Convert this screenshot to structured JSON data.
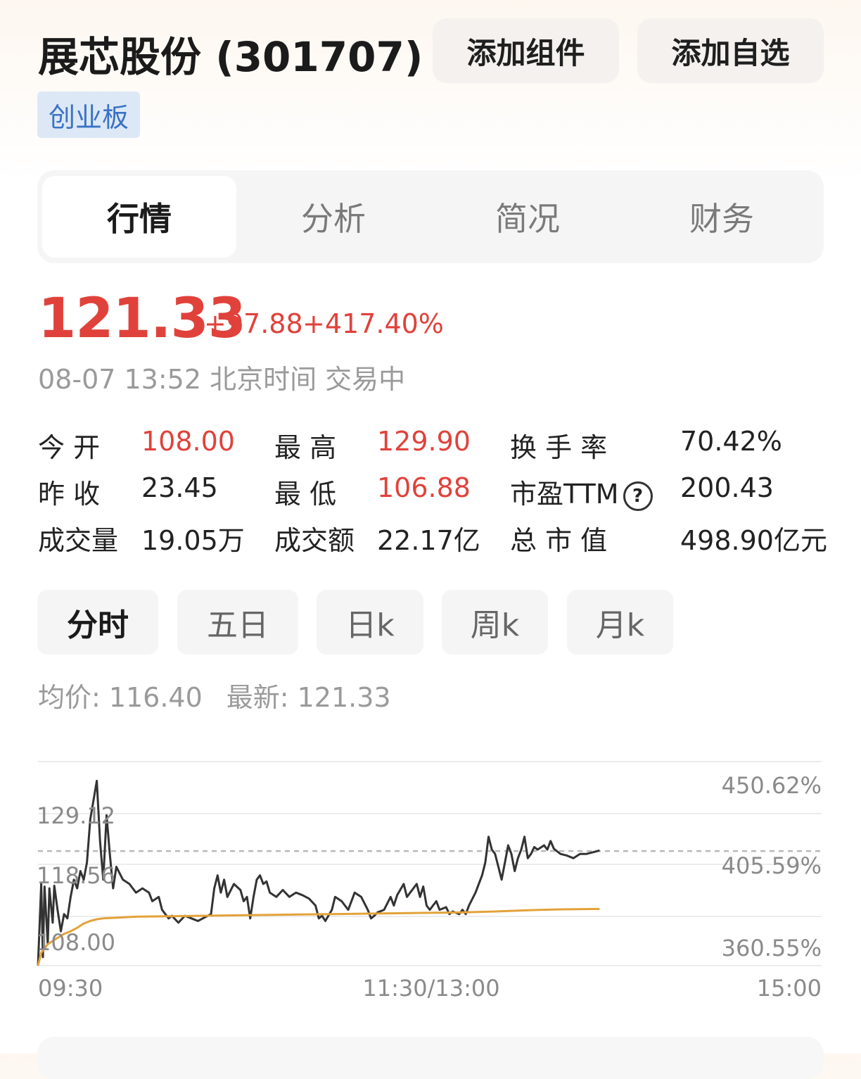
{
  "header": {
    "title": "展芯股份 (301707)",
    "add_widget_label": "添加组件",
    "add_watchlist_label": "添加自选",
    "board_tag": "创业板"
  },
  "tabs": [
    {
      "label": "行情",
      "active": true
    },
    {
      "label": "分析",
      "active": false
    },
    {
      "label": "简况",
      "active": false
    },
    {
      "label": "财务",
      "active": false
    }
  ],
  "quote": {
    "price": "121.33",
    "change": "+97.88",
    "change_pct": "+417.40%",
    "timestamp": "08-07 13:52 北京时间 交易中"
  },
  "stats": {
    "open_label": "今 开",
    "open": "108.00",
    "high_label": "最 高",
    "high": "129.90",
    "turnover_label": "换 手 率",
    "turnover": "70.42%",
    "prev_close_label": "昨 收",
    "prev_close": "23.45",
    "low_label": "最 低",
    "low": "106.88",
    "pe_label": "市盈TTM",
    "pe_help_icon": "?",
    "pe": "200.43",
    "volume_label": "成交量",
    "volume": "19.05万",
    "amount_label": "成交额",
    "amount": "22.17亿",
    "mktcap_label": "总 市 值",
    "mktcap": "498.90亿元"
  },
  "period_tabs": [
    {
      "label": "分时",
      "active": true
    },
    {
      "label": "五日",
      "active": false
    },
    {
      "label": "日k",
      "active": false
    },
    {
      "label": "周k",
      "active": false
    },
    {
      "label": "月k",
      "active": false
    }
  ],
  "intraday": {
    "avg_label": "均价:",
    "avg_value": "116.40",
    "latest_label": "最新:",
    "latest_value": "121.33"
  },
  "colors": {
    "up": "#e0423b",
    "price_line": "#333333",
    "avg_line": "#e3a23a"
  },
  "chart_data": {
    "type": "line",
    "x_ticks": [
      "09:30",
      "11:30/13:00",
      "15:00"
    ],
    "y_left_ticks": [
      "129.12",
      "118.56",
      "108.00"
    ],
    "y_right_ticks": [
      "450.62%",
      "405.59%",
      "360.55%"
    ],
    "ylim": [
      108.0,
      129.12
    ],
    "reference_line": 121.33,
    "x_total_minutes": 240,
    "series": [
      {
        "role": "price",
        "points": [
          [
            0,
            108.0
          ],
          [
            1,
            117.5
          ],
          [
            1.5,
            109.0
          ],
          [
            2,
            117.2
          ],
          [
            3,
            110.5
          ],
          [
            3.5,
            117.0
          ],
          [
            4.5,
            113.0
          ],
          [
            5,
            117.3
          ],
          [
            6,
            114.5
          ],
          [
            7,
            112.0
          ],
          [
            8,
            114.0
          ],
          [
            9,
            113.5
          ],
          [
            10,
            116.0
          ],
          [
            11,
            118.0
          ],
          [
            12,
            117.0
          ],
          [
            13,
            119.0
          ],
          [
            14,
            118.0
          ],
          [
            15,
            120.0
          ],
          [
            16,
            125.0
          ],
          [
            18,
            129.5
          ],
          [
            19,
            122.5
          ],
          [
            20,
            118.0
          ],
          [
            21,
            125.5
          ],
          [
            22,
            121.0
          ],
          [
            23,
            117.0
          ],
          [
            24,
            119.5
          ],
          [
            26,
            118.0
          ],
          [
            28,
            117.5
          ],
          [
            30,
            116.5
          ],
          [
            32,
            117.0
          ],
          [
            34,
            116.5
          ],
          [
            35,
            115.5
          ],
          [
            37,
            116.0
          ],
          [
            38,
            114.5
          ],
          [
            40,
            113.5
          ],
          [
            41,
            113.8
          ],
          [
            43,
            113.0
          ],
          [
            45,
            113.8
          ],
          [
            47,
            113.5
          ],
          [
            49,
            113.2
          ],
          [
            51,
            113.6
          ],
          [
            53,
            114.0
          ],
          [
            54,
            117.0
          ],
          [
            55,
            118.5
          ],
          [
            56,
            116.5
          ],
          [
            57,
            118.0
          ],
          [
            58,
            116.0
          ],
          [
            60,
            117.5
          ],
          [
            62,
            116.8
          ],
          [
            63,
            115.5
          ],
          [
            64,
            116.0
          ],
          [
            65,
            113.5
          ],
          [
            66,
            116.0
          ],
          [
            67,
            118.0
          ],
          [
            68,
            118.5
          ],
          [
            69,
            117.5
          ],
          [
            70,
            117.8
          ],
          [
            71,
            116.5
          ],
          [
            73,
            116.0
          ],
          [
            75,
            116.8
          ],
          [
            77,
            116.0
          ],
          [
            79,
            116.5
          ],
          [
            81,
            116.2
          ],
          [
            83,
            115.8
          ],
          [
            85,
            115.0
          ],
          [
            86,
            113.5
          ],
          [
            87,
            113.8
          ],
          [
            88,
            113.2
          ],
          [
            90,
            114.5
          ],
          [
            91,
            116.0
          ],
          [
            93,
            115.5
          ],
          [
            95,
            114.5
          ],
          [
            97,
            116.5
          ],
          [
            99,
            116.0
          ],
          [
            101,
            114.5
          ],
          [
            102,
            113.5
          ],
          [
            103,
            113.8
          ],
          [
            104,
            114.2
          ],
          [
            106,
            114.5
          ],
          [
            108,
            116.0
          ],
          [
            109,
            115.0
          ],
          [
            110,
            116.2
          ],
          [
            112,
            117.5
          ],
          [
            113,
            116.0
          ],
          [
            114,
            116.5
          ],
          [
            116,
            117.5
          ],
          [
            117,
            116.0
          ],
          [
            118,
            117.2
          ],
          [
            119,
            115.0
          ],
          [
            120,
            114.5
          ],
          [
            121,
            115.0
          ],
          [
            122,
            115.5
          ],
          [
            123,
            114.5
          ],
          [
            125,
            114.8
          ],
          [
            126,
            114.0
          ],
          [
            127,
            114.3
          ],
          [
            129,
            114.0
          ],
          [
            130,
            114.5
          ],
          [
            131,
            114.0
          ],
          [
            132,
            115.0
          ],
          [
            134,
            116.5
          ],
          [
            136,
            118.5
          ],
          [
            137,
            120.0
          ],
          [
            138,
            123.0
          ],
          [
            139,
            121.5
          ],
          [
            140,
            121.0
          ],
          [
            141,
            119.5
          ],
          [
            142,
            118.0
          ],
          [
            143,
            120.0
          ],
          [
            144,
            122.0
          ],
          [
            145,
            121.0
          ],
          [
            146,
            119.0
          ],
          [
            147,
            120.5
          ],
          [
            148,
            121.5
          ],
          [
            149,
            123.0
          ],
          [
            150,
            120.5
          ],
          [
            151,
            121.0
          ],
          [
            152,
            121.8
          ],
          [
            153,
            121.5
          ],
          [
            155,
            122.0
          ],
          [
            156,
            121.5
          ],
          [
            157,
            122.5
          ],
          [
            158,
            121.6
          ],
          [
            160,
            121.0
          ],
          [
            162,
            120.8
          ],
          [
            164,
            120.5
          ],
          [
            166,
            121.0
          ],
          [
            168,
            121.0
          ],
          [
            170,
            121.2
          ],
          [
            172,
            121.4
          ]
        ]
      },
      {
        "role": "average",
        "points": [
          [
            0,
            108.0
          ],
          [
            1,
            109.5
          ],
          [
            3,
            110.5
          ],
          [
            5,
            111.0
          ],
          [
            8,
            111.7
          ],
          [
            10,
            112.0
          ],
          [
            12,
            112.4
          ],
          [
            14,
            112.9
          ],
          [
            16,
            113.2
          ],
          [
            18,
            113.4
          ],
          [
            20,
            113.5
          ],
          [
            25,
            113.6
          ],
          [
            30,
            113.7
          ],
          [
            40,
            113.75
          ],
          [
            50,
            113.8
          ],
          [
            60,
            113.85
          ],
          [
            70,
            113.9
          ],
          [
            80,
            113.95
          ],
          [
            90,
            114.0
          ],
          [
            100,
            114.05
          ],
          [
            110,
            114.1
          ],
          [
            120,
            114.15
          ],
          [
            130,
            114.2
          ],
          [
            140,
            114.3
          ],
          [
            150,
            114.45
          ],
          [
            160,
            114.55
          ],
          [
            172,
            114.6
          ]
        ]
      }
    ]
  }
}
